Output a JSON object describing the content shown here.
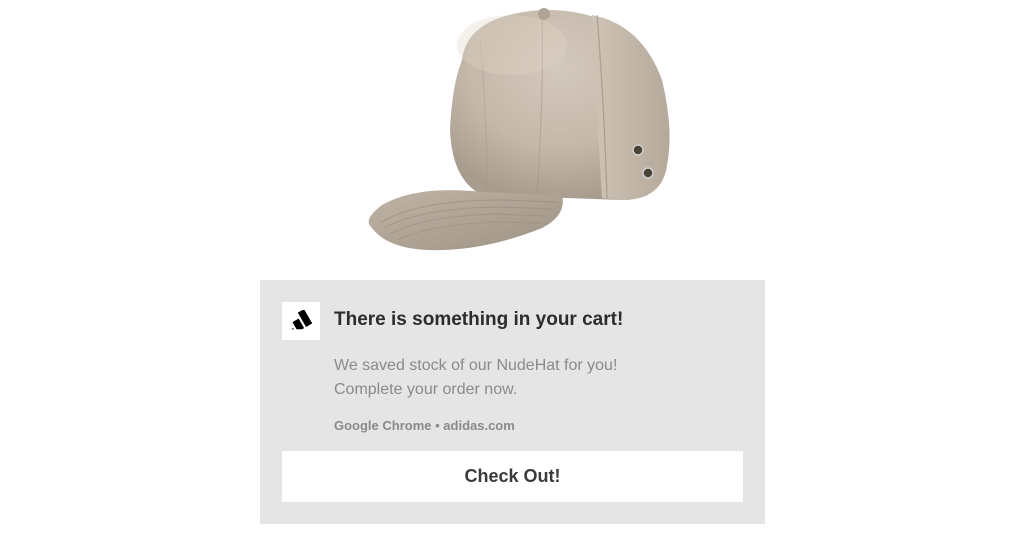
{
  "notification": {
    "title": "There is something in your cart!",
    "body_line1": "We saved stock of our NudeHat for you!",
    "body_line2": "Complete your order now.",
    "source": "Google Chrome • adidas.com",
    "cta_label": "Check Out!",
    "brand": "adidas"
  },
  "product": {
    "name": "NudeHat",
    "type": "cap"
  }
}
